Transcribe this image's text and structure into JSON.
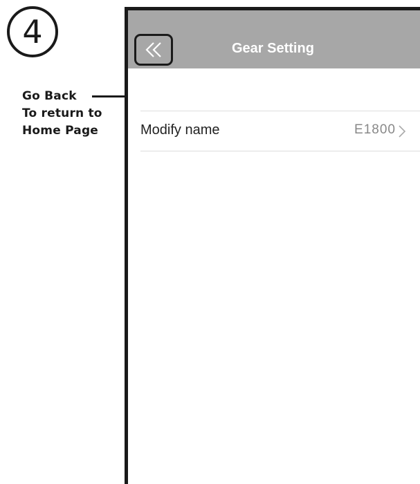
{
  "step": {
    "number": "4"
  },
  "annotation": {
    "lines": [
      "Go Back",
      "To return to",
      "Home Page"
    ]
  },
  "header": {
    "title": "Gear Setting",
    "back_icon": "double-chevron-left-icon",
    "background_color": "#a7a7a7"
  },
  "settings": {
    "items": [
      {
        "label": "Modify name",
        "value": "E1800",
        "icon": "chevron-right-icon"
      }
    ]
  }
}
